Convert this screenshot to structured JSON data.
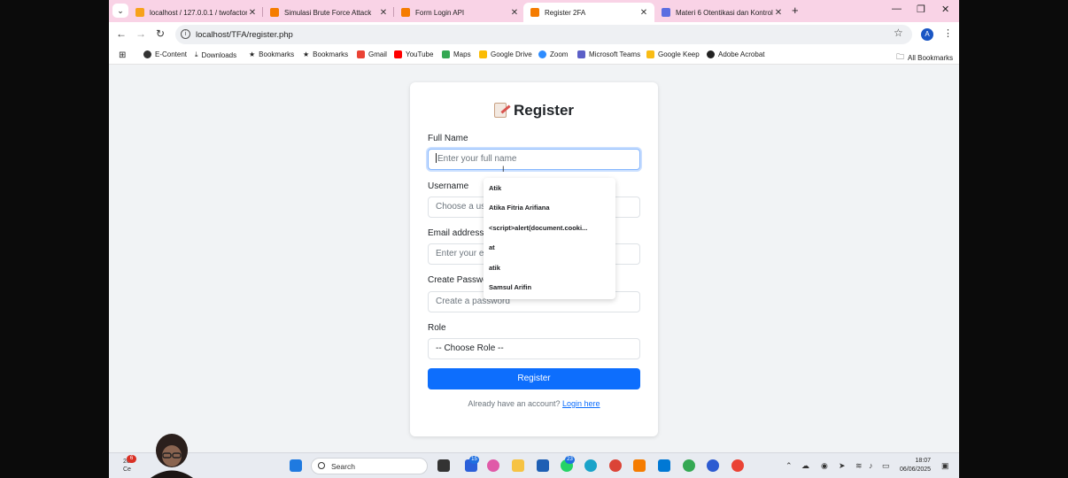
{
  "browser": {
    "tabs": [
      {
        "title": "localhost / 127.0.0.1 / twofactor",
        "icon": "phpmyadmin-icon",
        "color": "#f7a21b"
      },
      {
        "title": "Simulasi Brute Force Attack",
        "icon": "xampp-icon",
        "color": "#f57c00"
      },
      {
        "title": "Form Login API",
        "icon": "xampp-icon",
        "color": "#f57c00"
      },
      {
        "title": "Register 2FA",
        "icon": "xampp-icon",
        "color": "#f57c00",
        "active": true
      },
      {
        "title": "Materi 6 Otentikasi dan Kontrol",
        "icon": "chat-icon",
        "color": "#5b6ee1"
      }
    ],
    "url": "localhost/TFA/register.php",
    "avatar_letter": "A",
    "bookmarks": [
      {
        "label": "E-Content",
        "icon": "globe-icon"
      },
      {
        "label": "Downloads",
        "icon": "download-icon"
      },
      {
        "label": "Bookmarks",
        "icon": "star-icon"
      },
      {
        "label": "Bookmarks",
        "icon": "star-icon"
      },
      {
        "label": "Gmail",
        "icon": "gmail-icon"
      },
      {
        "label": "YouTube",
        "icon": "youtube-icon"
      },
      {
        "label": "Maps",
        "icon": "maps-icon"
      },
      {
        "label": "Google Drive",
        "icon": "drive-icon"
      },
      {
        "label": "Zoom",
        "icon": "zoom-icon"
      },
      {
        "label": "Microsoft Teams",
        "icon": "teams-icon"
      },
      {
        "label": "Google Keep",
        "icon": "keep-icon"
      },
      {
        "label": "Adobe Acrobat",
        "icon": "acrobat-icon"
      }
    ],
    "all_bookmarks": "All Bookmarks"
  },
  "form": {
    "title": "Register",
    "full_name_label": "Full Name",
    "full_name_placeholder": "Enter your full name",
    "username_label": "Username",
    "username_placeholder": "Choose a us",
    "email_label": "Email address",
    "email_placeholder": "Enter your e",
    "password_label": "Create Passwo",
    "password_placeholder": "Create a password",
    "role_label": "Role",
    "role_selected": "-- Choose Role --",
    "submit_label": "Register",
    "footer_text": "Already have an account?",
    "footer_link": "Login here",
    "accent_color": "#0d6efd"
  },
  "autocomplete": [
    "Atik",
    "Atika Fitria Arifiana",
    "<script>alert(document.cooki...",
    "at",
    "atik",
    "Samsul Arifin"
  ],
  "taskbar": {
    "weather_temp": "26°",
    "weather_text": "Ce",
    "weather_badge": "6",
    "search_label": "Search",
    "badges": {
      "phone": "15",
      "whatsapp": "23"
    },
    "time": "18:07",
    "date": "06/06/2025"
  }
}
